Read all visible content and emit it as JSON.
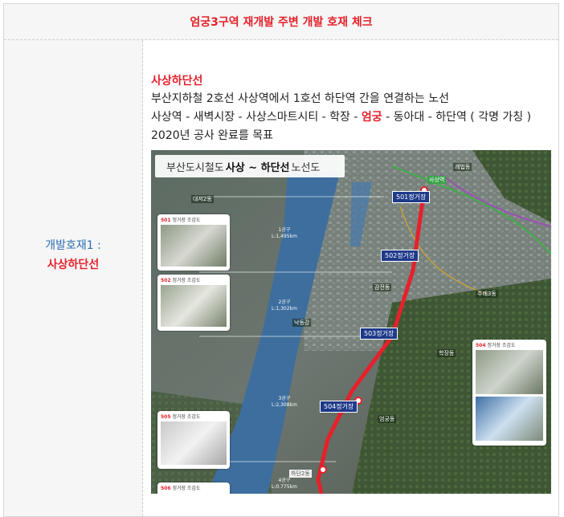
{
  "header": {
    "title": "엄궁3구역 재개발 주변 개발 호재 체크"
  },
  "left": {
    "label1": "개발호재1 :",
    "label2": "사상하단선"
  },
  "content": {
    "title": "사상하단선",
    "line1": "부산지하철 2호선 사상역에서 1호선 하단역 간을 연결하는 노선",
    "line2_pre": "사상역 - 새벽시장 - 사상스마트시티 - 학장 - ",
    "line2_hl": "엄궁",
    "line2_post": " - 동아대 - 하단역 ( 각명 가칭 )",
    "line3": "2020년 공사 완료를 목표"
  },
  "map": {
    "title_pre": "부산도시철도",
    "title_bold": "사상 ~ 하단선",
    "title_post": "노선도",
    "stations": [
      "501정거장",
      "502정거장",
      "503정거장",
      "504정거장",
      "하단2동"
    ],
    "segments": [
      {
        "name": "1공구",
        "len": "L:1,495km"
      },
      {
        "name": "2공구",
        "len": "L:1,302km"
      },
      {
        "name": "3공구",
        "len": "L:2,308km"
      },
      {
        "name": "4공구",
        "len": "L:0.775km"
      }
    ],
    "insets": [
      {
        "no": "501",
        "cap": "정거장 조감도"
      },
      {
        "no": "502",
        "cap": "정거장 조감도"
      },
      {
        "no": "505",
        "cap": "정거장 조감도"
      },
      {
        "no": "506",
        "cap": "정거장 조감도"
      },
      {
        "no": "504",
        "cap": "정거장 조감도"
      }
    ],
    "district_labels": [
      "대저2동",
      "괘법동",
      "사상역",
      "학장동",
      "주례3동",
      "엄궁동",
      "낙동강",
      "감전동"
    ],
    "colors": {
      "route": "#e5212b",
      "station_bg": "#1f3a8a",
      "river": "#3d6e9e"
    }
  }
}
